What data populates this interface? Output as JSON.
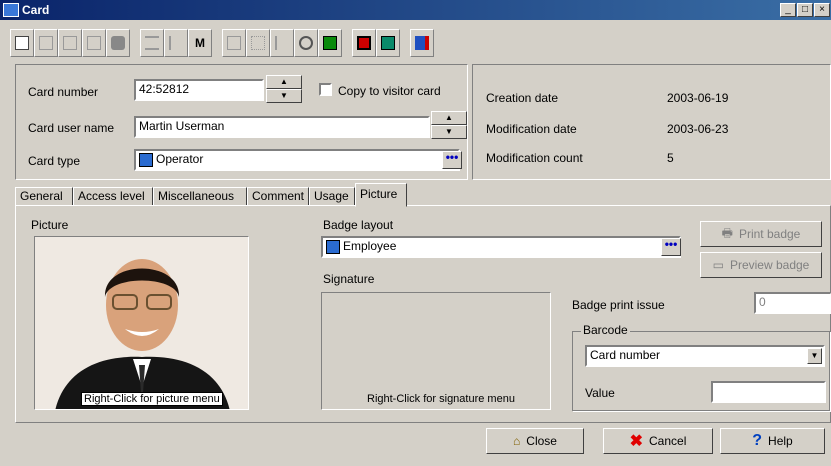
{
  "window": {
    "title": "Card"
  },
  "toolbar": {
    "buttons": [
      "new-icon",
      "save-icon",
      "copy-icon",
      "delete-icon",
      "print-icon",
      "list-icon",
      "edit-icon",
      "find-icon",
      "binoculars-icon",
      "table-icon",
      "tools-icon",
      "network-icon",
      "grid-icon",
      "report-icon",
      "cards-icon",
      "badge-icon"
    ]
  },
  "card": {
    "number_label": "Card number",
    "number_value": "42:52812",
    "copy_label": "Copy to visitor card",
    "user_label": "Card user name",
    "user_value": "Martin Userman",
    "type_label": "Card type",
    "type_value": "Operator"
  },
  "info": {
    "creation_label": "Creation date",
    "creation_value": "2003-06-19",
    "modification_label": "Modification date",
    "modification_value": "2003-06-23",
    "count_label": "Modification count",
    "count_value": "5"
  },
  "tabs": [
    "General",
    "Access level",
    "Miscellaneous",
    "Comment",
    "Usage",
    "Picture"
  ],
  "picture_tab": {
    "picture_label": "Picture",
    "picture_hint": "Right-Click for picture menu",
    "badge_layout_label": "Badge layout",
    "badge_layout_value": "Employee",
    "signature_label": "Signature",
    "signature_hint": "Right-Click for signature menu",
    "print_badge": "Print badge",
    "preview_badge": "Preview badge",
    "badge_print_issue_label": "Badge print issue",
    "badge_print_issue_value": "0",
    "barcode_label": "Barcode",
    "barcode_value": "Card number",
    "value_label": "Value",
    "value_value": ""
  },
  "footer": {
    "close": "Close",
    "cancel": "Cancel",
    "help": "Help"
  },
  "colors": {
    "title": "#0a246a",
    "face": "#d4d0c8",
    "cancel_x": "#e00000",
    "help_q": "#0040c0"
  }
}
